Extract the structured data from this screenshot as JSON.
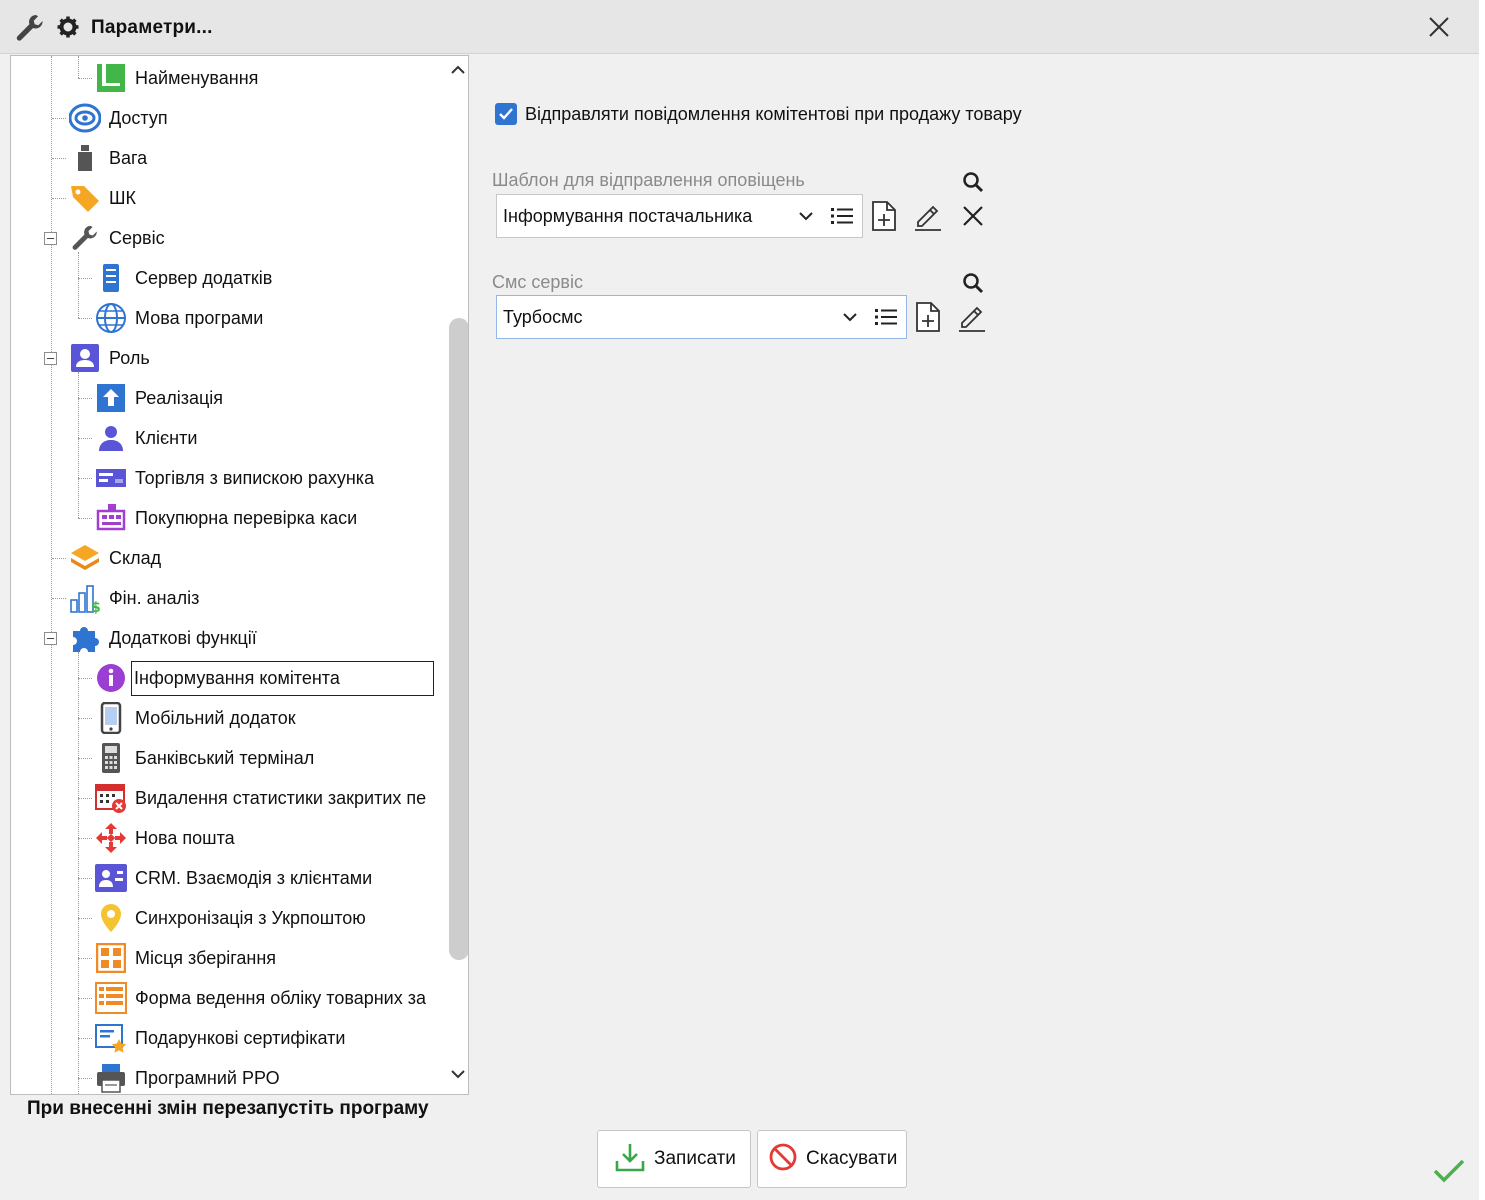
{
  "window": {
    "title": "Параметри...",
    "close_label": "×"
  },
  "tree": {
    "items": [
      {
        "label": "Найменування",
        "icon": "naming-icon"
      },
      {
        "label": "Доступ",
        "icon": "eye-icon"
      },
      {
        "label": "Вага",
        "icon": "weight-icon"
      },
      {
        "label": "ШК",
        "icon": "tag-icon"
      },
      {
        "label": "Сервіс",
        "icon": "wrench-icon"
      },
      {
        "label": "Сервер додатків",
        "icon": "server-icon"
      },
      {
        "label": "Мова програми",
        "icon": "globe-icon"
      },
      {
        "label": "Роль",
        "icon": "user-card-icon"
      },
      {
        "label": "Реалізація",
        "icon": "upload-arrow-icon"
      },
      {
        "label": "Клієнти",
        "icon": "person-icon"
      },
      {
        "label": "Торгівля з випискою рахунка",
        "icon": "invoice-icon"
      },
      {
        "label": "Покупюрна перевірка каси",
        "icon": "cash-register-icon"
      },
      {
        "label": "Склад",
        "icon": "layers-icon"
      },
      {
        "label": "Фін. аналіз",
        "icon": "finance-chart-icon"
      },
      {
        "label": "Додаткові функції",
        "icon": "puzzle-icon"
      },
      {
        "label": "Інформування комітента",
        "icon": "info-icon"
      },
      {
        "label": "Мобільний додаток",
        "icon": "mobile-icon"
      },
      {
        "label": "Банківський термінал",
        "icon": "terminal-icon"
      },
      {
        "label": "Видалення статистики закритих пе",
        "icon": "calendar-delete-icon"
      },
      {
        "label": "Нова пошта",
        "icon": "nova-poshta-icon"
      },
      {
        "label": "CRM. Взаємодія з клієнтами",
        "icon": "crm-icon"
      },
      {
        "label": "Синхронізація з Укрпоштою",
        "icon": "map-pin-icon"
      },
      {
        "label": "Місця зберігання",
        "icon": "storage-icon"
      },
      {
        "label": "Форма ведення обліку товарних за",
        "icon": "form-list-icon"
      },
      {
        "label": "Подарункові сертифікати",
        "icon": "certificate-icon"
      },
      {
        "label": "Програмний РРО",
        "icon": "printer-icon"
      }
    ]
  },
  "settings": {
    "checkbox_label": "Відправляти повідомлення комітентові при продажу товару",
    "checkbox_checked": true,
    "template_label": "Шаблон для відправлення оповіщень",
    "template_value": "Інформування постачальника",
    "sms_label": "Смс сервіс",
    "sms_value": "Турбосмс"
  },
  "footer": {
    "restart_note": "При внесенні змін перезапустіть програму",
    "save_label": "Записати",
    "cancel_label": "Скасувати"
  },
  "colors": {
    "accent_blue": "#2f74d0",
    "ok_green": "#4caf50",
    "cancel_red": "#e53935",
    "save_green": "#3aa64a"
  }
}
